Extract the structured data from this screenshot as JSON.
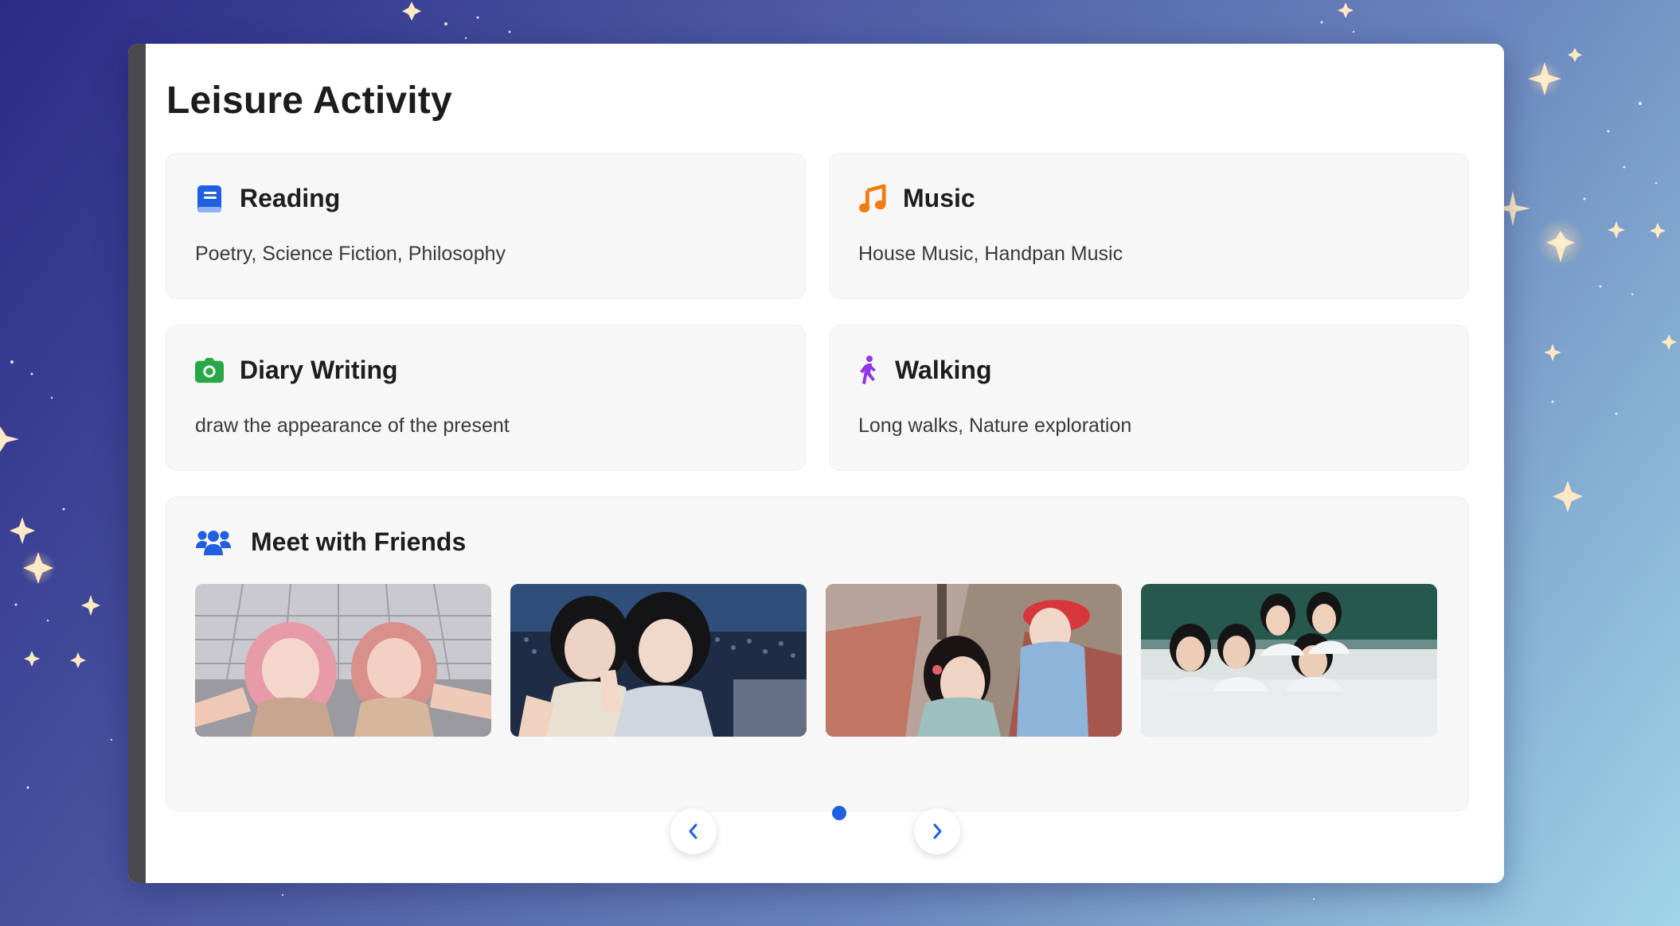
{
  "page": {
    "title": "Leisure Activity"
  },
  "activities": [
    {
      "title": "Reading",
      "description": "Poetry, Science Fiction, Philosophy",
      "icon": "book-icon",
      "color": "#1f5fe0"
    },
    {
      "title": "Music",
      "description": "House Music, Handpan Music",
      "icon": "music-note-icon",
      "color": "#f27b0c"
    },
    {
      "title": "Diary Writing",
      "description": "draw the appearance of the present",
      "icon": "camera-icon",
      "color": "#27a745"
    },
    {
      "title": "Walking",
      "description": "Long walks, Nature exploration",
      "icon": "walking-person-icon",
      "color": "#9333ea"
    }
  ],
  "friends": {
    "title": "Meet with Friends",
    "icon": "users-icon",
    "color": "#1f5fe0",
    "photos": [
      {
        "name": "friends-photo-cosplay"
      },
      {
        "name": "friends-photo-concert"
      },
      {
        "name": "friends-photo-street"
      },
      {
        "name": "friends-photo-classroom"
      }
    ]
  },
  "pagination": {
    "current_page": 1,
    "total_pages": 1,
    "prev_icon": "chevron-left-icon",
    "next_icon": "chevron-right-icon",
    "accent": "#1f5fe0"
  }
}
